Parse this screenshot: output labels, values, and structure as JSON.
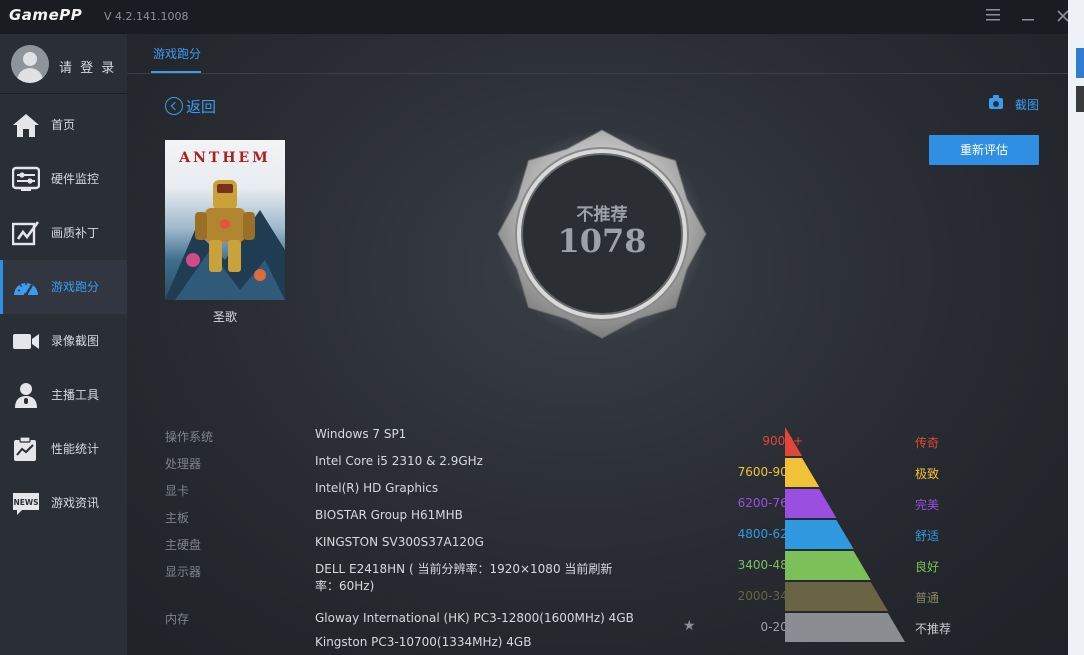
{
  "app": {
    "logo": "GamePP",
    "version": "V 4.2.141.1008"
  },
  "window": {
    "menu_icon": "menu-icon",
    "minimize_icon": "minimize-icon",
    "close_icon": "close-icon"
  },
  "user": {
    "login_label": "请 登 录"
  },
  "sidebar": {
    "items": [
      {
        "label": "首页",
        "icon": "home-icon"
      },
      {
        "label": "硬件监控",
        "icon": "hardware-monitor-icon"
      },
      {
        "label": "画质补丁",
        "icon": "image-patch-icon"
      },
      {
        "label": "游戏跑分",
        "icon": "speedometer-icon",
        "active": true
      },
      {
        "label": "录像截图",
        "icon": "video-camera-icon"
      },
      {
        "label": "主播工具",
        "icon": "streamer-icon"
      },
      {
        "label": "性能统计",
        "icon": "stats-clipboard-icon"
      },
      {
        "label": "游戏资讯",
        "icon": "news-icon"
      }
    ]
  },
  "tabs": [
    {
      "label": "游戏跑分",
      "active": true
    }
  ],
  "actions": {
    "back_label": "返回",
    "screenshot_label": "截图",
    "reevaluate_label": "重新评估"
  },
  "game": {
    "cover_title": "ANTHEM",
    "name": "圣歌"
  },
  "score": {
    "verdict": "不推荐",
    "value": "1078"
  },
  "specs": [
    {
      "key": "操作系统",
      "value": "Windows 7 SP1"
    },
    {
      "key": "处理器",
      "value": "Intel Core i5 2310 & 2.9GHz"
    },
    {
      "key": "显卡",
      "value": "Intel(R) HD Graphics"
    },
    {
      "key": "主板",
      "value": "BIOSTAR Group H61MHB"
    },
    {
      "key": "主硬盘",
      "value": "KINGSTON SV300S37A120G"
    },
    {
      "key": "显示器",
      "value": "DELL E2418HN ( 当前分辨率：1920×1080 当前刷新率：60Hz)"
    },
    {
      "key": "内存",
      "value": "Gloway International (HK) PC3-12800(1600MHz) 4GB"
    },
    {
      "key": "",
      "value": "Kingston PC3-10700(1334MHz) 4GB"
    }
  ],
  "tiers": [
    {
      "range": "9000+",
      "name": "传奇",
      "color": "#e0463a"
    },
    {
      "range": "7600-9000",
      "name": "极致",
      "color": "#f0c23a"
    },
    {
      "range": "6200-7600",
      "name": "完美",
      "color": "#9b4fe0"
    },
    {
      "range": "4800-6200",
      "name": "舒适",
      "color": "#2f9ae0"
    },
    {
      "range": "3400-4800",
      "name": "良好",
      "color": "#7cc05a"
    },
    {
      "range": "2000-3400",
      "name": "普通",
      "color": "#6b6444"
    },
    {
      "range": "0-2000",
      "name": "不推荐",
      "color": "#8a8d91",
      "current": true
    }
  ]
}
